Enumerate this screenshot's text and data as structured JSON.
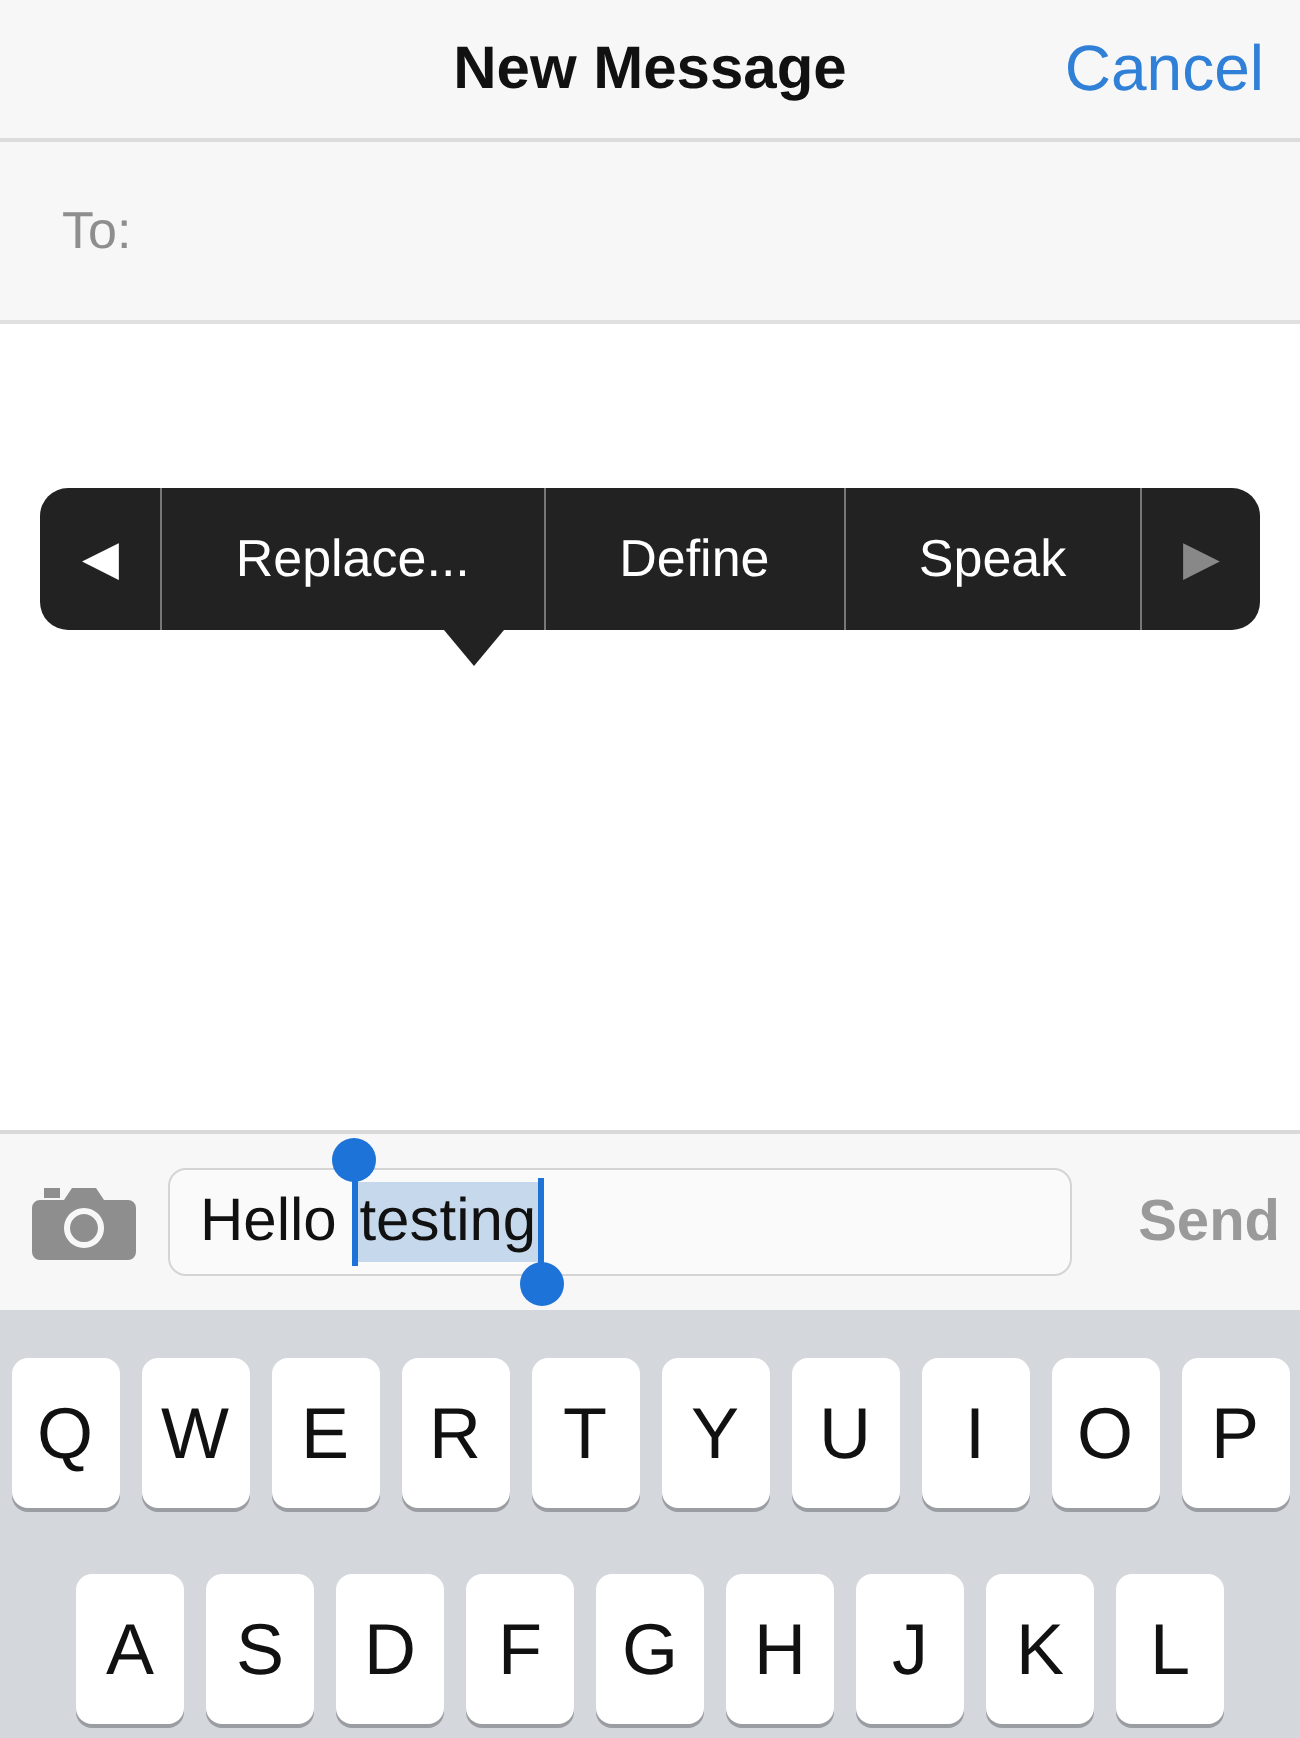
{
  "nav_bar": {
    "title": "New Message",
    "cancel": "Cancel"
  },
  "to_field": {
    "label": "To:"
  },
  "edit_menu": {
    "prev": {
      "label": "◀",
      "disabled": false
    },
    "items": [
      "Replace...",
      "Define",
      "Speak"
    ],
    "next": {
      "label": "▶",
      "disabled": true
    }
  },
  "composer": {
    "text": "Hello",
    "selected_text": "testing",
    "send": {
      "label": "Send",
      "disabled": true
    }
  },
  "keyboard": {
    "rows": [
      [
        "Q",
        "W",
        "E",
        "R",
        "T",
        "Y",
        "U",
        "I",
        "O",
        "P"
      ],
      [
        "A",
        "S",
        "D",
        "F",
        "G",
        "H",
        "J",
        "K",
        "L"
      ]
    ]
  }
}
